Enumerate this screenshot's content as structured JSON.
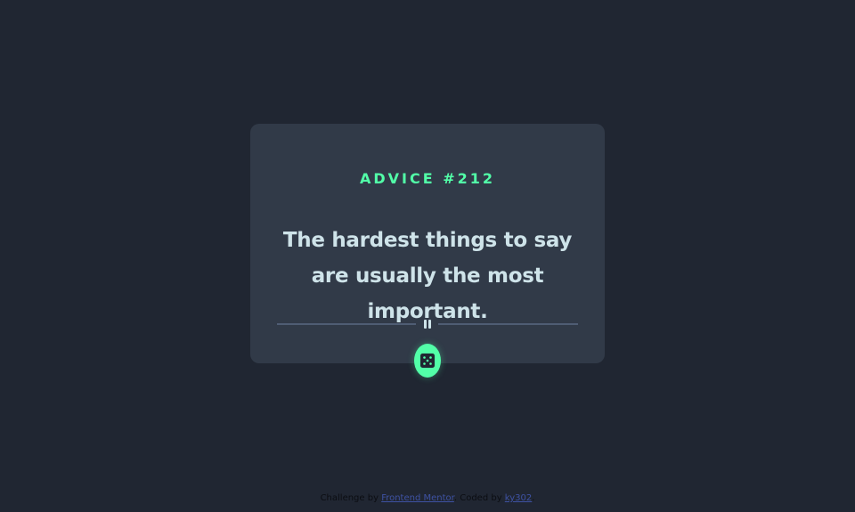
{
  "card": {
    "advice_id": "ADVICE #212",
    "advice_text": "The hardest things to say are usually the most important."
  },
  "divider": {
    "icon": "pause-icon"
  },
  "dice_button": {
    "icon": "dice-icon"
  },
  "attribution": {
    "challenge_prefix": "Challenge by ",
    "challenge_link": "Frontend Mentor",
    "coded_prefix": ". Coded by ",
    "coded_link": "ky302",
    "suffix": "."
  },
  "colors": {
    "background": "#202632",
    "card": "#313a48",
    "accent": "#52ffa8",
    "text": "#cee3e9",
    "divider": "#4f5d74",
    "link": "#3e52a3"
  }
}
